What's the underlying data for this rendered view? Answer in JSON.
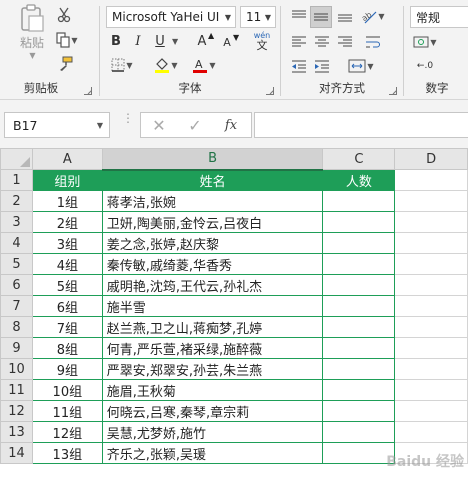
{
  "ribbon": {
    "clipboard": {
      "paste_label": "粘贴",
      "group_label": "剪贴板"
    },
    "font": {
      "font_name": "Microsoft YaHei UI",
      "font_size": "11",
      "bold": "B",
      "italic": "I",
      "underline": "U",
      "grow": "A",
      "shrink": "A",
      "phonetic": "wén",
      "group_label": "字体"
    },
    "alignment": {
      "group_label": "对齐方式"
    },
    "number": {
      "format": "常规",
      "group_label": "数字"
    }
  },
  "formula_bar": {
    "name_box": "B17",
    "fx": "fx",
    "value": ""
  },
  "sheet": {
    "columns": [
      "A",
      "B",
      "C",
      "D"
    ],
    "headers": {
      "group": "组别",
      "name": "姓名",
      "count": "人数"
    },
    "rows": [
      {
        "row": "1"
      },
      {
        "row": "2",
        "group": "1组",
        "name": "蒋孝洁,张婉"
      },
      {
        "row": "3",
        "group": "2组",
        "name": "卫妍,陶美丽,金怜云,吕夜白"
      },
      {
        "row": "4",
        "group": "3组",
        "name": "姜之念,张婷,赵庆黎"
      },
      {
        "row": "5",
        "group": "4组",
        "name": "秦传敏,戚绮菱,华香秀"
      },
      {
        "row": "6",
        "group": "5组",
        "name": "戚明艳,沈筠,王代云,孙礼杰"
      },
      {
        "row": "7",
        "group": "6组",
        "name": "施半雪"
      },
      {
        "row": "8",
        "group": "7组",
        "name": "赵兰燕,卫之山,蒋痴梦,孔婷"
      },
      {
        "row": "9",
        "group": "8组",
        "name": "何青,严乐萱,褚采绿,施醉薇"
      },
      {
        "row": "10",
        "group": "9组",
        "name": "严翠安,郑翠安,孙芸,朱兰燕"
      },
      {
        "row": "11",
        "group": "10组",
        "name": "施眉,王秋菊"
      },
      {
        "row": "12",
        "group": "11组",
        "name": "何晓云,吕寒,秦琴,章宗莉"
      },
      {
        "row": "13",
        "group": "12组",
        "name": "吴慧,尤梦娇,施竹"
      },
      {
        "row": "14",
        "group": "13组",
        "name": "齐乐之,张颖,吴瑗"
      }
    ]
  },
  "watermark": "Baidu 经验",
  "colors": {
    "header_green": "#1e9e58",
    "excel_green": "#217346"
  }
}
